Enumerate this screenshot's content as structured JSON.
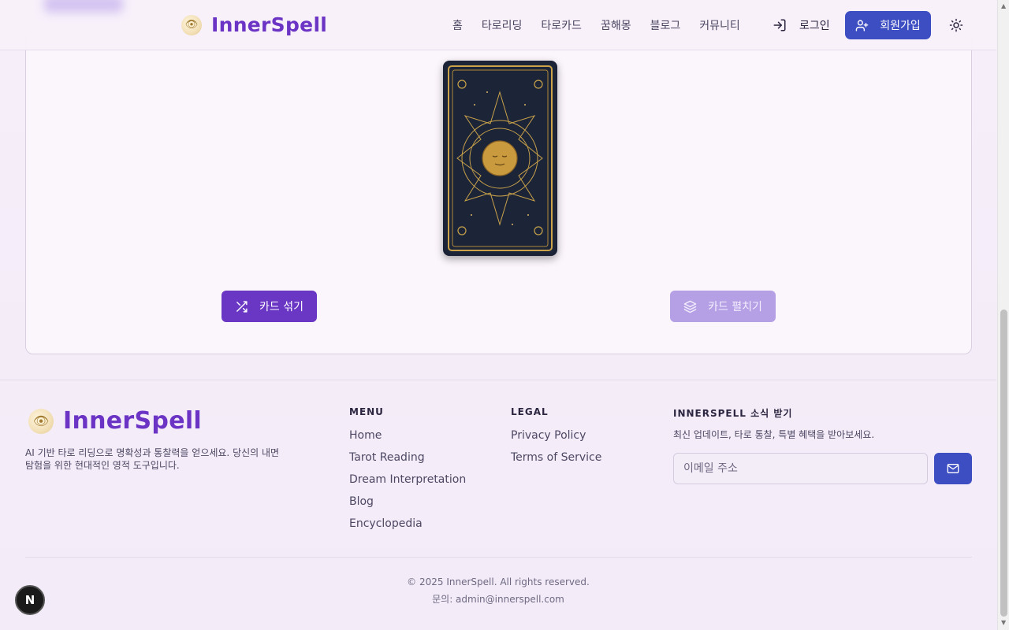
{
  "header": {
    "brand": "InnerSpell",
    "nav": [
      "홈",
      "타로리딩",
      "타로카드",
      "꿈해몽",
      "블로그",
      "커뮤니티"
    ],
    "login_label": "로그인",
    "signup_label": "회원가입"
  },
  "main": {
    "shuffle_label": "카드 섞기",
    "spread_label": "카드 펼치기"
  },
  "footer": {
    "brand": "InnerSpell",
    "description": "AI 기반 타로 리딩으로 명확성과 통찰력을 얻으세요. 당신의 내면 탐험을 위한 현대적인 영적 도구입니다.",
    "menu_title": "MENU",
    "menu": [
      "Home",
      "Tarot Reading",
      "Dream Interpretation",
      "Blog",
      "Encyclopedia"
    ],
    "legal_title": "LEGAL",
    "legal": [
      "Privacy Policy",
      "Terms of Service"
    ],
    "newsletter_title": "INNERSPELL 소식 받기",
    "newsletter_desc": "최신 업데이트, 타로 통찰, 특별 혜택을 받아보세요.",
    "email_placeholder": "이메일 주소",
    "copyright": "© 2025 InnerSpell. All rights reserved.",
    "contact": "문의: admin@innerspell.com"
  },
  "colors": {
    "brand_purple": "#6c34c4",
    "primary_blue": "#3d4ec2",
    "shuffle_purple": "#6a36c4",
    "disabled_lavender": "#b5a0e6"
  },
  "icons": [
    "eye-logo-icon",
    "login-icon",
    "user-plus-icon",
    "sun-icon",
    "shuffle-icon",
    "layers-icon",
    "mail-icon"
  ]
}
